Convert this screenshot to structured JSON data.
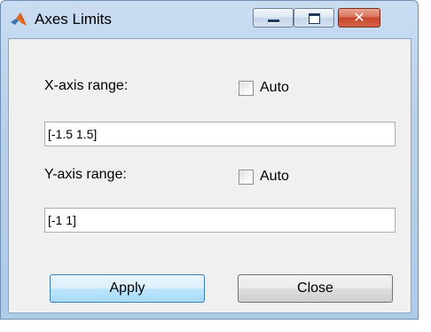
{
  "window": {
    "title": "Axes Limits",
    "close_glyph": "✕"
  },
  "x_axis": {
    "label": "X-axis range:",
    "auto_label": "Auto",
    "auto_checked": false,
    "value": "[-1.5 1.5]"
  },
  "y_axis": {
    "label": "Y-axis range:",
    "auto_label": "Auto",
    "auto_checked": false,
    "value": "[-1 1]"
  },
  "buttons": {
    "apply_label": "Apply",
    "close_label": "Close"
  },
  "icons": {
    "app": "matlab-icon",
    "minimize": "minimize-icon",
    "maximize": "maximize-icon",
    "close": "close-icon"
  },
  "colors": {
    "titlebar": "#b9d0ea",
    "client_bg": "#f0f0f0",
    "close_button": "#c8472c",
    "apply_button": "#bee6fd"
  }
}
